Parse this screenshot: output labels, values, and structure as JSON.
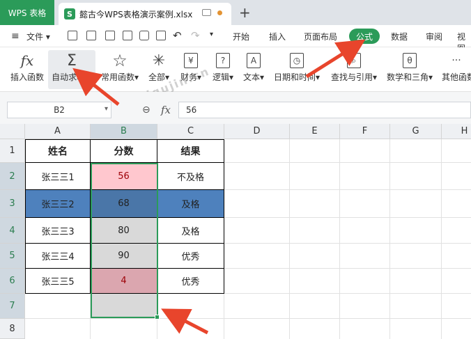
{
  "titlebar": {
    "app_tab": "WPS 表格",
    "doc_tab": "懿古今WPS表格演示案例.xlsx",
    "new_tab": "+",
    "file_icon": "xls-icon",
    "file_icon_glyph": "S"
  },
  "menubar": {
    "file_menu": "文件",
    "tabs": [
      "开始",
      "插入",
      "页面布局",
      "公式",
      "数据",
      "审阅",
      "视图"
    ],
    "active_tab": "公式"
  },
  "ribbon": {
    "buttons": [
      {
        "label": "插入函数",
        "icon": "fx-icon",
        "glyph": "fx"
      },
      {
        "label": "自动求和",
        "icon": "sigma-icon",
        "glyph": "Σ"
      },
      {
        "label": "常用函数",
        "icon": "star-icon",
        "glyph": "☆"
      },
      {
        "label": "全部",
        "icon": "asterisk-icon",
        "glyph": "✳"
      },
      {
        "label": "财务",
        "icon": "yen-icon",
        "glyph": "¥"
      },
      {
        "label": "逻辑",
        "icon": "logic-icon",
        "glyph": "?"
      },
      {
        "label": "文本",
        "icon": "text-icon",
        "glyph": "A"
      },
      {
        "label": "日期和时间",
        "icon": "clock-icon",
        "glyph": "◷"
      },
      {
        "label": "查找与引用",
        "icon": "lookup-icon",
        "glyph": "⌕"
      },
      {
        "label": "数学和三角",
        "icon": "math-icon",
        "glyph": "θ"
      },
      {
        "label": "其他函数",
        "icon": "more-icon",
        "glyph": "···"
      }
    ]
  },
  "formula_bar": {
    "name_box": "B2",
    "fx_label": "fx",
    "value": "56"
  },
  "watermark": "yigujin.cn",
  "sheet": {
    "columns": [
      "A",
      "B",
      "C",
      "D",
      "E",
      "F",
      "G",
      "H"
    ],
    "rows": [
      "1",
      "2",
      "3",
      "4",
      "5",
      "6",
      "7",
      "8"
    ],
    "header": {
      "name": "姓名",
      "score": "分数",
      "result": "结果"
    },
    "data": [
      {
        "name": "张三三1",
        "score": "56",
        "result": "不及格"
      },
      {
        "name": "张三三2",
        "score": "68",
        "result": "及格"
      },
      {
        "name": "张三三3",
        "score": "80",
        "result": "及格"
      },
      {
        "name": "张三三4",
        "score": "90",
        "result": "优秀"
      },
      {
        "name": "张三三5",
        "score": "4",
        "result": "优秀"
      }
    ],
    "colors": {
      "highlight_row": "#4e81bd",
      "fail_cell": "#ffc7ce",
      "low_cell": "#dba6af",
      "selected_fill": "#d9d9d9",
      "accent": "#2b9b59",
      "arrow": "#e8452c"
    }
  }
}
